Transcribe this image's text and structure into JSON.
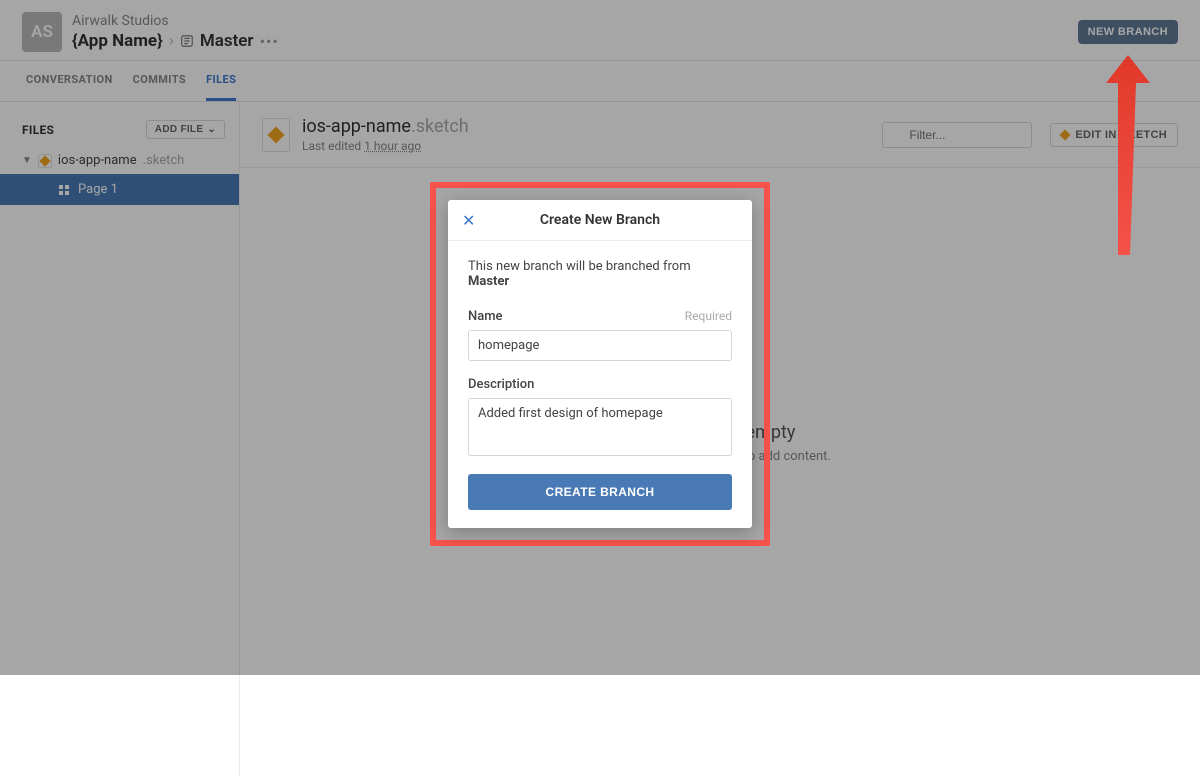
{
  "header": {
    "avatar_initials": "AS",
    "org": "Airwalk Studios",
    "app_name": "{App Name}",
    "branch": "Master",
    "new_branch_label": "NEW BRANCH"
  },
  "tabs": {
    "conversation": "CONVERSATION",
    "commits": "COMMITS",
    "files": "FILES"
  },
  "sidebar": {
    "files_label": "FILES",
    "add_file_label": "ADD FILE",
    "file_name": "ios-app-name",
    "file_ext": ".sketch",
    "page": "Page 1"
  },
  "file": {
    "name": "ios-app-name",
    "ext": ".sketch",
    "last_edited_prefix": "Last edited ",
    "last_edited_time": "1 hour ago",
    "filter_placeholder": "Filter...",
    "edit_in_sketch": "EDIT IN SKETCH"
  },
  "empty": {
    "title": "This page is empty",
    "subtitle": "Open this file in Sketch to add content."
  },
  "modal": {
    "title": "Create New Branch",
    "desc_prefix": "This new branch will be branched from ",
    "desc_branch": "Master",
    "name_label": "Name",
    "required_label": "Required",
    "name_value": "homepage",
    "description_label": "Description",
    "description_value": "Added first design of homepage",
    "create_label": "CREATE BRANCH"
  }
}
